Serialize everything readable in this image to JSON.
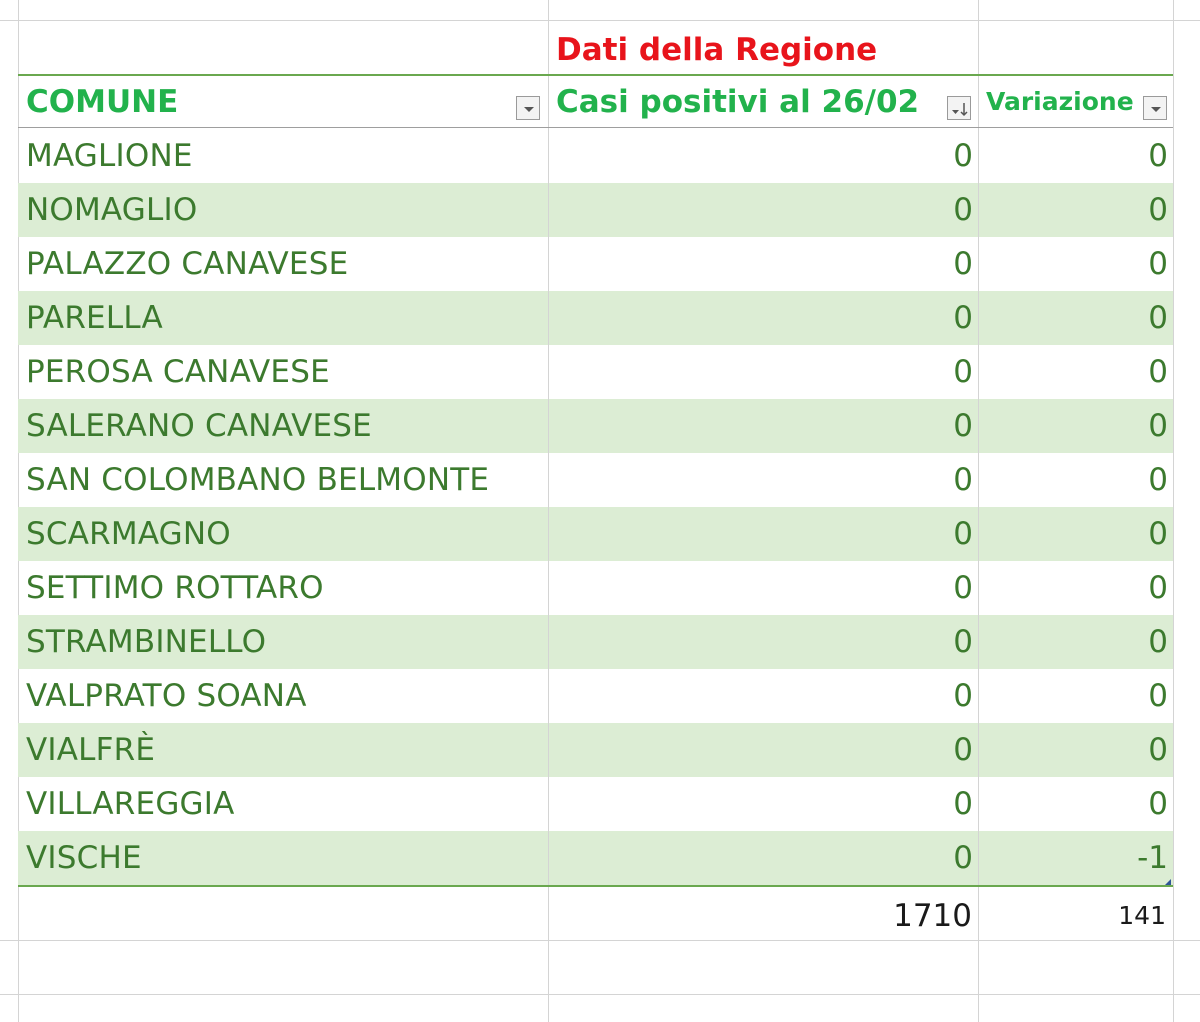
{
  "header": {
    "region_title": "Dati della Regione",
    "col_comune": "COMUNE",
    "col_casi": "Casi positivi al 26/02",
    "col_variazione": "Variazione"
  },
  "rows": [
    {
      "comune": "MAGLIONE",
      "casi": "0",
      "variazione": "0"
    },
    {
      "comune": "NOMAGLIO",
      "casi": "0",
      "variazione": "0"
    },
    {
      "comune": "PALAZZO CANAVESE",
      "casi": "0",
      "variazione": "0"
    },
    {
      "comune": "PARELLA",
      "casi": "0",
      "variazione": "0"
    },
    {
      "comune": "PEROSA CANAVESE",
      "casi": "0",
      "variazione": "0"
    },
    {
      "comune": "SALERANO CANAVESE",
      "casi": "0",
      "variazione": "0"
    },
    {
      "comune": "SAN COLOMBANO BELMONTE",
      "casi": "0",
      "variazione": "0"
    },
    {
      "comune": "SCARMAGNO",
      "casi": "0",
      "variazione": "0"
    },
    {
      "comune": "SETTIMO ROTTARO",
      "casi": "0",
      "variazione": "0"
    },
    {
      "comune": "STRAMBINELLO",
      "casi": "0",
      "variazione": "0"
    },
    {
      "comune": "VALPRATO SOANA",
      "casi": "0",
      "variazione": "0"
    },
    {
      "comune": "VIALFRÈ",
      "casi": "0",
      "variazione": "0"
    },
    {
      "comune": "VILLAREGGIA",
      "casi": "0",
      "variazione": "0"
    },
    {
      "comune": "VISCHE",
      "casi": "0",
      "variazione": "-1"
    }
  ],
  "totals": {
    "casi": "1710",
    "variazione": "141"
  },
  "colors": {
    "header_green": "#22b24c",
    "row_text_green": "#3c7a2e",
    "band_green": "#dcedd4",
    "region_red": "#e8141b"
  },
  "icons": {
    "filter_dropdown": "filter-dropdown-icon",
    "sort_descending": "sort-descending-icon"
  }
}
